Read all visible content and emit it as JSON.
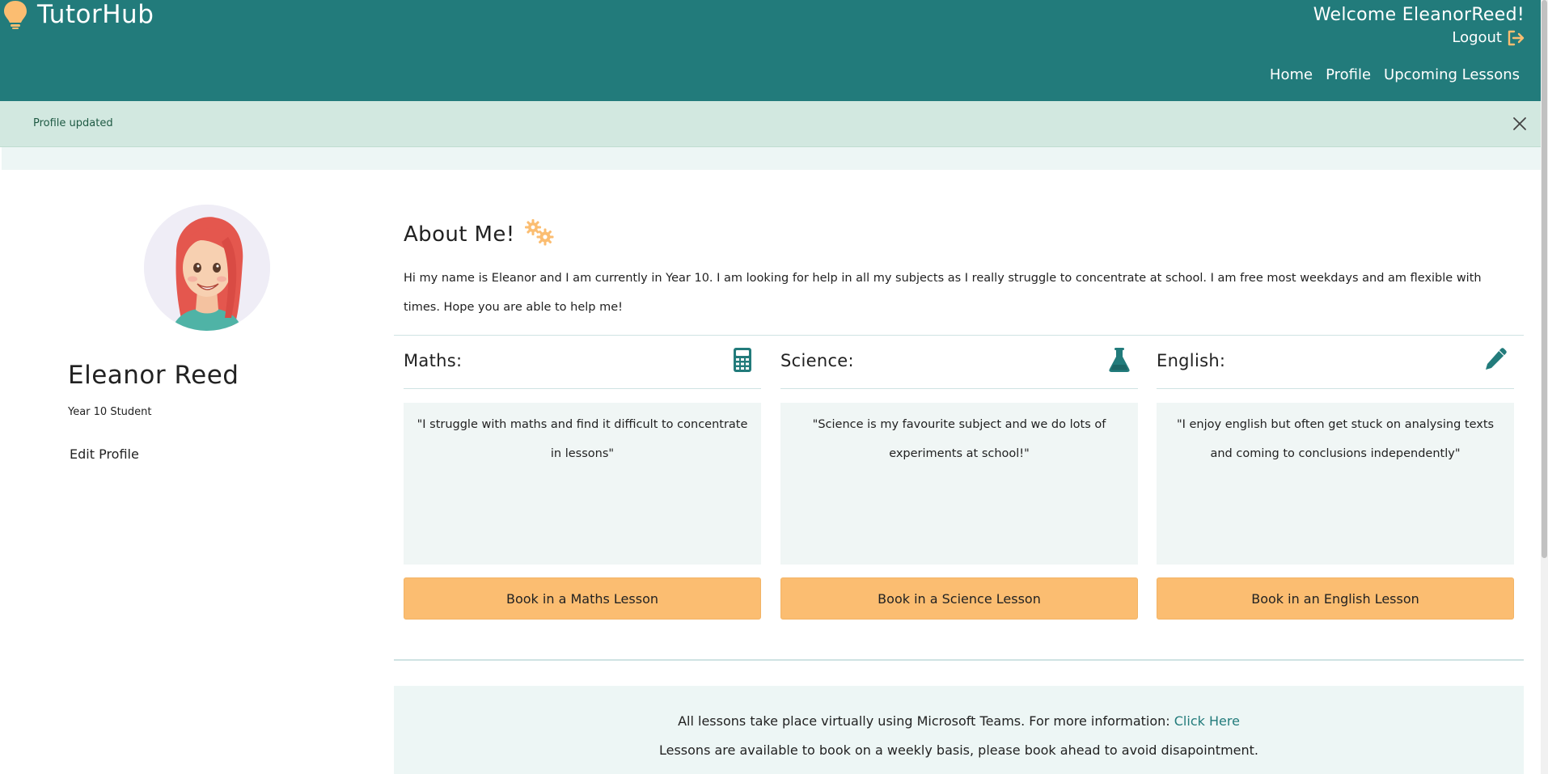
{
  "header": {
    "brand": "TutorHub",
    "welcome": "Welcome EleanorReed!",
    "logout_label": "Logout",
    "nav": [
      "Home",
      "Profile",
      "Upcoming Lessons"
    ]
  },
  "alert": {
    "message": "Profile updated"
  },
  "profile": {
    "name": "Eleanor Reed",
    "year": "Year 10 Student",
    "edit_label": "Edit Profile"
  },
  "about": {
    "title": "About Me!",
    "text": "Hi my name is Eleanor and I am currently in Year 10. I am looking for help in all my subjects as I really struggle to concentrate at school. I am free most weekdays and am flexible with times. Hope you are able to help me!"
  },
  "subjects": [
    {
      "title": "Maths:",
      "icon": "calculator-icon",
      "quote": "\"I struggle with maths and find it difficult to concentrate in lessons\"",
      "button": "Book in a Maths Lesson"
    },
    {
      "title": "Science:",
      "icon": "flask-icon",
      "quote": "\"Science is my favourite subject and we do lots of experiments at school!\"",
      "button": "Book in a Science Lesson"
    },
    {
      "title": "English:",
      "icon": "pencil-icon",
      "quote": "\"I enjoy english but often get stuck on analysing texts and coming to conclusions independently\"",
      "button": "Book in an English Lesson"
    }
  ],
  "info": {
    "line1_text": "All lessons take place virtually using Microsoft Teams. For more information:",
    "line1_link": "Click Here",
    "line2": "Lessons are available to book on a weekly basis, please book ahead to avoid disapointment."
  },
  "colors": {
    "header_bg": "#227b7b",
    "accent_orange": "#fbbd71",
    "alert_bg": "#d2e8e0",
    "panel_bg": "#f0f6f5"
  }
}
